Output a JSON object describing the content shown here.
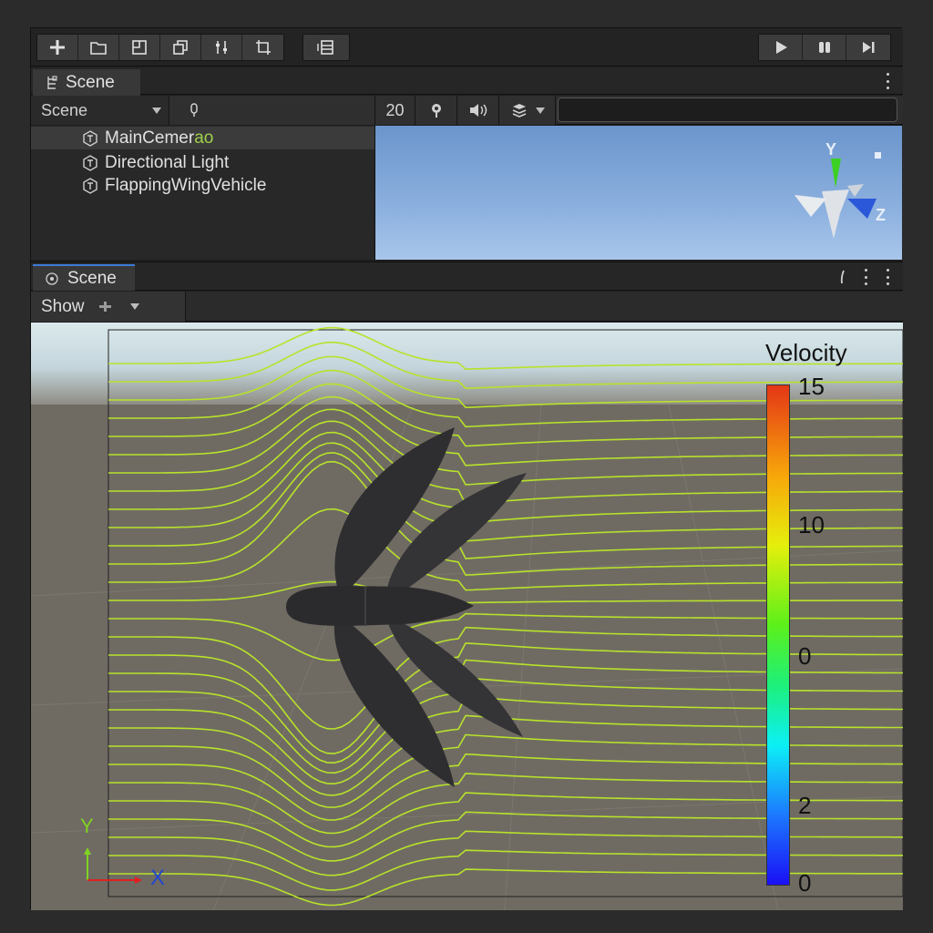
{
  "toolbar": {
    "buttons": [
      "add-icon",
      "folder-icon",
      "grid-icon",
      "layers-icon",
      "sliders-icon",
      "crop-icon"
    ],
    "layout_icon": "layout-icon",
    "play_icon": "play-icon",
    "pause_icon": "pause-icon",
    "step_icon": "step-icon"
  },
  "hierarchy_tab": {
    "label": "Scene"
  },
  "bar2": {
    "dropdown_value": "Scene",
    "mic_icon": "mic-icon",
    "count": "20",
    "gizmo_icon": "pin-icon",
    "audio_icon": "speaker-icon",
    "layers_icon": "stack-icon"
  },
  "hierarchy": {
    "items": [
      {
        "label": "MainCemer",
        "label_highlight": "ao"
      },
      {
        "label": "Directional Light"
      },
      {
        "label": "FlappingWingVehicle"
      }
    ]
  },
  "preview": {
    "axis_y": "Y",
    "axis_z": "Z"
  },
  "scene_tab": {
    "label": "Scene"
  },
  "bar3": {
    "show_label": "Show"
  },
  "viewport": {
    "legend_title": "Velocity",
    "ticks": [
      "15",
      "10",
      "0",
      "2",
      "0"
    ],
    "axis_y": "Y",
    "axis_x": "X",
    "streamline_color": "#b8e22a"
  }
}
